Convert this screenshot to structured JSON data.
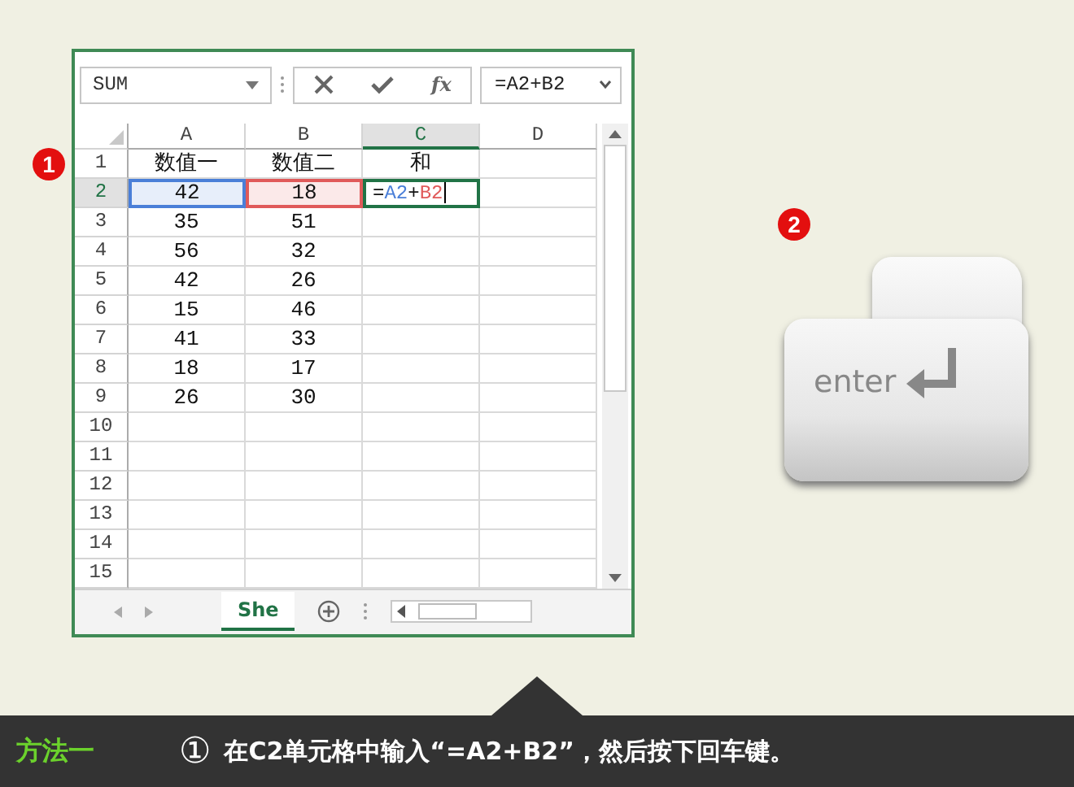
{
  "badges": [
    {
      "label": "1"
    },
    {
      "label": "2"
    }
  ],
  "formula_bar": {
    "name_box": "SUM",
    "function_label": "fx",
    "formula": "=A2+B2"
  },
  "columns": [
    {
      "label": "A",
      "selected": false
    },
    {
      "label": "B",
      "selected": false
    },
    {
      "label": "C",
      "selected": true
    },
    {
      "label": "D",
      "selected": false
    }
  ],
  "rows": [
    {
      "number": "1",
      "selected": false,
      "cells": [
        {
          "value": "数值一"
        },
        {
          "value": "数值二"
        },
        {
          "value": "和"
        }
      ]
    },
    {
      "number": "2",
      "selected": true,
      "cells": [
        {
          "value": "42",
          "color": "#4a7fd8"
        },
        {
          "value": "18",
          "color": "#e05a5a"
        },
        {
          "editing": true,
          "parts": [
            {
              "text": "="
            },
            {
              "text": "A2",
              "color": "#4a7fd8"
            },
            {
              "text": "+"
            },
            {
              "text": "B2",
              "color": "#e05a5a"
            }
          ]
        }
      ]
    },
    {
      "number": "3",
      "selected": false,
      "cells": [
        {
          "value": "35"
        },
        {
          "value": "51"
        }
      ]
    },
    {
      "number": "4",
      "selected": false,
      "cells": [
        {
          "value": "56"
        },
        {
          "value": "32"
        }
      ]
    },
    {
      "number": "5",
      "selected": false,
      "cells": [
        {
          "value": "42"
        },
        {
          "value": "26"
        }
      ]
    },
    {
      "number": "6",
      "selected": false,
      "cells": [
        {
          "value": "15"
        },
        {
          "value": "46"
        }
      ]
    },
    {
      "number": "7",
      "selected": false,
      "cells": [
        {
          "value": "41"
        },
        {
          "value": "33"
        }
      ]
    },
    {
      "number": "8",
      "selected": false,
      "cells": [
        {
          "value": "18"
        },
        {
          "value": "17"
        }
      ]
    },
    {
      "number": "9",
      "selected": false,
      "cells": [
        {
          "value": "26"
        },
        {
          "value": "30"
        }
      ]
    },
    {
      "number": "10",
      "selected": false
    },
    {
      "number": "11",
      "selected": false
    },
    {
      "number": "12",
      "selected": false
    },
    {
      "number": "13",
      "selected": false
    },
    {
      "number": "14",
      "selected": false
    },
    {
      "number": "15",
      "selected": false
    }
  ],
  "sheet_tabs": [
    {
      "label": "She",
      "selected": true
    }
  ],
  "key": {
    "label": "enter"
  },
  "footer": {
    "title": "方法一",
    "step": "①",
    "instruction": "在C2单元格中输入“=A2+B2”，然后按下回车键。"
  }
}
